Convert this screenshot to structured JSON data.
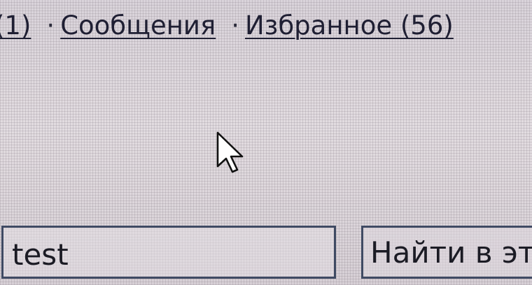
{
  "nav": {
    "first_count": "(1)",
    "messages_label": "Сообщения",
    "favorites_label": "Избранное (56)",
    "separator": "·"
  },
  "cursor": {
    "icon": "arrow-cursor-icon"
  },
  "search": {
    "value": "test",
    "button_label": "Найти в эт"
  }
}
